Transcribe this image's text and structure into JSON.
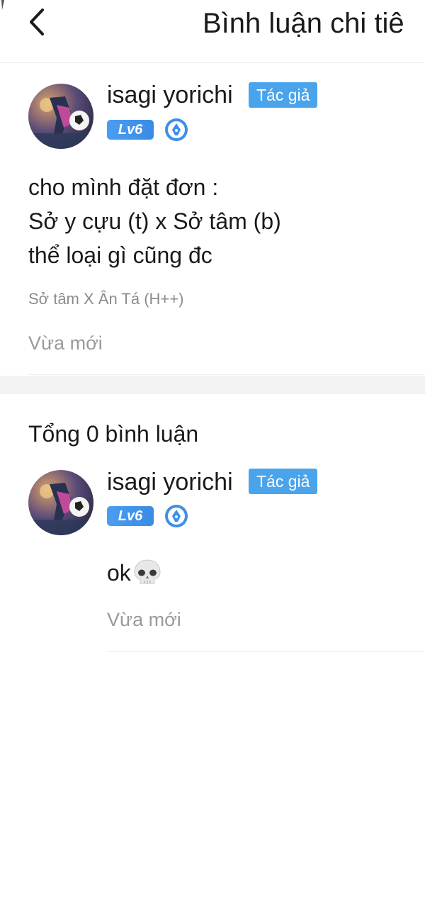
{
  "header": {
    "back_icon": "chevron-left-icon",
    "title": "Bình luận chi tiê"
  },
  "post": {
    "username": "isagi yorichi",
    "author_badge": "Tác giả",
    "level_badge": "Lv6",
    "lines": [
      "cho mình đặt đơn :",
      "Sở y cựu (t) x Sở tâm (b)",
      "thể loại gì cũng đc"
    ],
    "tag": "Sở tâm X Ân Tá (H++)",
    "time": "Vừa mới"
  },
  "comments": {
    "total_label": "Tổng 0 bình luận",
    "items": [
      {
        "username": "isagi yorichi",
        "author_badge": "Tác giả",
        "level_badge": "Lv6",
        "text": "ok",
        "emoji": "skull-icon",
        "time": "Vừa mới"
      }
    ]
  },
  "colors": {
    "accent": "#4aa4ec",
    "muted_text": "#9a9a9a",
    "divider": "#ececec",
    "section_gap": "#f3f3f3"
  }
}
